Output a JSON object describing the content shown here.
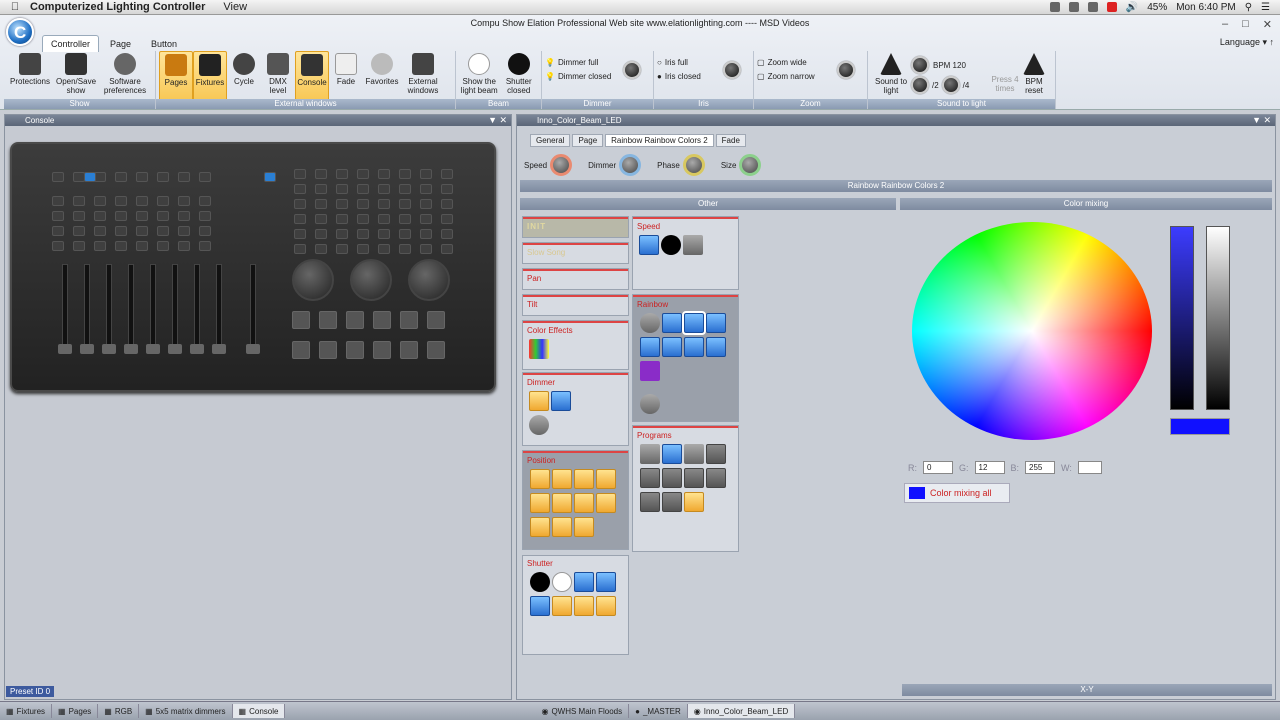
{
  "menubar": {
    "app_name": "Computerized Lighting Controller",
    "menu_view": "View",
    "battery": "45%",
    "clock": "Mon 6:40 PM"
  },
  "window": {
    "title": "Compu Show   Elation Professional   Web site  www.elationlighting.com ---- MSD Videos"
  },
  "tabs": [
    "Controller",
    "Page",
    "Button"
  ],
  "language": "Language",
  "ribbon": {
    "show": {
      "label": "Show",
      "buttons": [
        "Protections",
        "Open/Save show",
        "Software preferences"
      ]
    },
    "external": {
      "label": "External windows",
      "buttons": [
        "Pages",
        "Fixtures",
        "Cycle",
        "DMX level",
        "Console",
        "Fade",
        "Favorites",
        "External windows"
      ]
    },
    "beam": {
      "label": "Beam",
      "buttons": [
        "Show the light beam",
        "Shutter closed"
      ]
    },
    "dimmer": {
      "label": "Dimmer",
      "items": [
        "Dimmer full",
        "Dimmer closed"
      ]
    },
    "iris": {
      "label": "Iris",
      "items": [
        "Iris full",
        "Iris closed"
      ]
    },
    "zoom": {
      "label": "Zoom",
      "items": [
        "Zoom wide",
        "Zoom narrow"
      ]
    },
    "sound": {
      "label": "Sound to light",
      "sound_btn": "Sound to light",
      "bpm": "BPM 120",
      "div2": "/2",
      "div4": "/4",
      "press": "Press 4 times",
      "reset": "BPM reset"
    }
  },
  "console": {
    "title": "Console",
    "preset_id": "Preset ID 0"
  },
  "fixture": {
    "title": "Inno_Color_Beam_LED",
    "tabs": [
      "General",
      "Page",
      "Rainbow Rainbow Colors 2",
      "Fade"
    ],
    "params": [
      "Speed",
      "Dimmer",
      "Phase",
      "Size"
    ],
    "subtitle": "Rainbow Rainbow Colors 2",
    "other_label": "Other",
    "colormix_label": "Color mixing",
    "boxes": {
      "init": "INIT",
      "slow": "Slow Song",
      "pan": "Pan",
      "tilt": "Tilt",
      "color_effects": "Color Effects",
      "dimmer": "Dimmer",
      "position": "Position",
      "shutter": "Shutter",
      "speed": "Speed",
      "rainbow": "Rainbow",
      "programs": "Programs"
    },
    "rgb": {
      "r_label": "R:",
      "r": "0",
      "g_label": "G:",
      "g": "12",
      "b_label": "B:",
      "b": "255",
      "w_label": "W:",
      "w": ""
    },
    "color_mixing_all": "Color mixing all",
    "xy_label": "X-Y"
  },
  "statusbar": [
    "Fixtures",
    "Pages",
    "RGB",
    "5x5 matrix dimmers",
    "Console",
    "QWHS Main Floods",
    "_MASTER",
    "Inno_Color_Beam_LED"
  ]
}
